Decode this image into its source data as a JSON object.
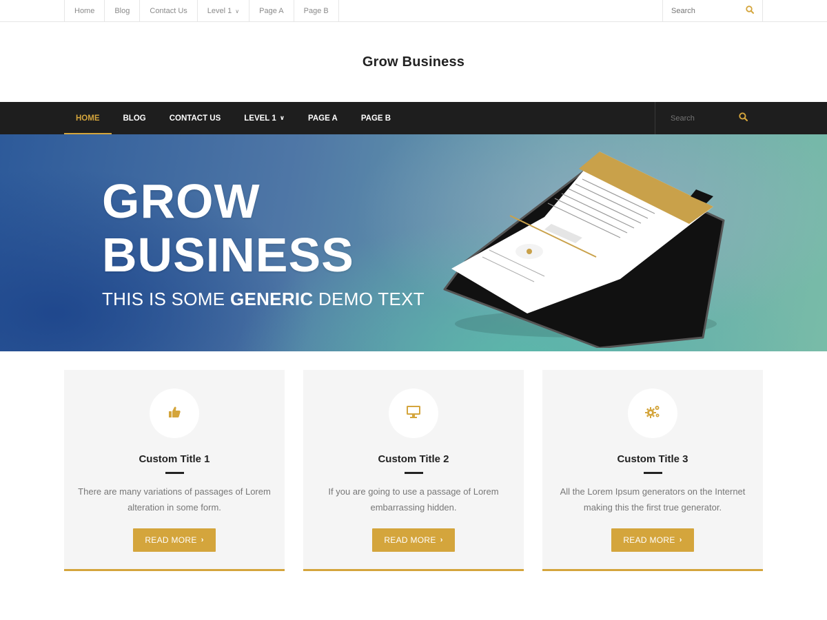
{
  "topbar": {
    "nav": [
      {
        "label": "Home"
      },
      {
        "label": "Blog"
      },
      {
        "label": "Contact Us"
      },
      {
        "label": "Level 1",
        "has_dropdown": true
      },
      {
        "label": "Page A"
      },
      {
        "label": "Page B"
      }
    ],
    "search_placeholder": "Search",
    "search_icon": "search-icon"
  },
  "header": {
    "site_title": "Grow Business"
  },
  "mainnav": {
    "items": [
      {
        "label": "HOME",
        "active": true
      },
      {
        "label": "BLOG"
      },
      {
        "label": "CONTACT US"
      },
      {
        "label": "LEVEL 1",
        "has_dropdown": true
      },
      {
        "label": "PAGE A"
      },
      {
        "label": "PAGE B"
      }
    ],
    "search_placeholder": "Search",
    "search_icon": "search-icon"
  },
  "hero": {
    "line1": "GROW",
    "line2": "BUSINESS",
    "sub_prefix": "THIS IS SOME ",
    "sub_bold": "GENERIC",
    "sub_suffix": " DEMO TEXT",
    "image": "phone-mockup"
  },
  "features": [
    {
      "icon": "thumbs-up-icon",
      "title": "Custom Title 1",
      "text": "There are many variations of passages of Lorem alteration in some form.",
      "button": "READ MORE"
    },
    {
      "icon": "monitor-icon",
      "title": "Custom Title 2",
      "text": "If you are going to use a passage of Lorem embarrassing hidden.",
      "button": "READ MORE"
    },
    {
      "icon": "gears-icon",
      "title": "Custom Title 3",
      "text": "All the Lorem Ipsum generators on the Internet making this the first true generator.",
      "button": "READ MORE"
    }
  ],
  "colors": {
    "accent": "#d4a53c",
    "nav_bg": "#1e1e1e",
    "card_bg": "#f5f5f5"
  }
}
